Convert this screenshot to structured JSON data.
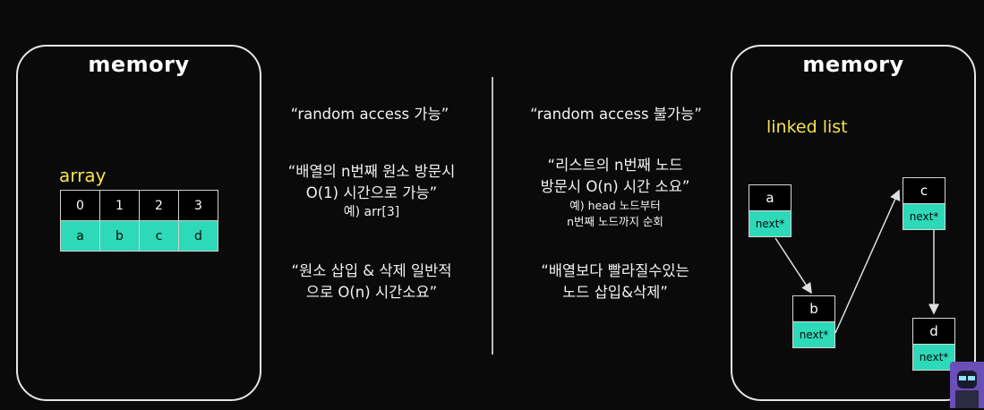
{
  "left_panel": {
    "title": "memory",
    "array_label": "array",
    "indices": [
      "0",
      "1",
      "2",
      "3"
    ],
    "values": [
      "a",
      "b",
      "c",
      "d"
    ]
  },
  "middle_left": {
    "point1": "“random access 가능”",
    "point2_line1": "“배열의 n번째 원소 방문시",
    "point2_line2": "O(1) 시간으로 가능”",
    "point2_example": "예) arr[3]",
    "point3_line1": "“원소 삽입 & 삭제 일반적",
    "point3_line2": "으로 O(n) 시간소요”"
  },
  "middle_right": {
    "point1": "“random access 불가능”",
    "point2_line1": "“리스트의 n번째 노드",
    "point2_line2": "방문시 O(n) 시간 소요”",
    "point2_example1": "예) head 노드부터",
    "point2_example2": "n번째 노드까지 순회",
    "point3_line1": "“배열보다 빨라질수있는",
    "point3_line2": "노드 삽입&삭제”"
  },
  "right_panel": {
    "title": "memory",
    "list_label": "linked list",
    "nodes": [
      {
        "name": "a",
        "next": "next*"
      },
      {
        "name": "b",
        "next": "next*"
      },
      {
        "name": "c",
        "next": "next*"
      },
      {
        "name": "d",
        "next": "next*"
      }
    ]
  },
  "colors": {
    "accent_teal": "#2dd9b8",
    "label_yellow": "#f4e24a",
    "background": "#0a0a0a"
  }
}
